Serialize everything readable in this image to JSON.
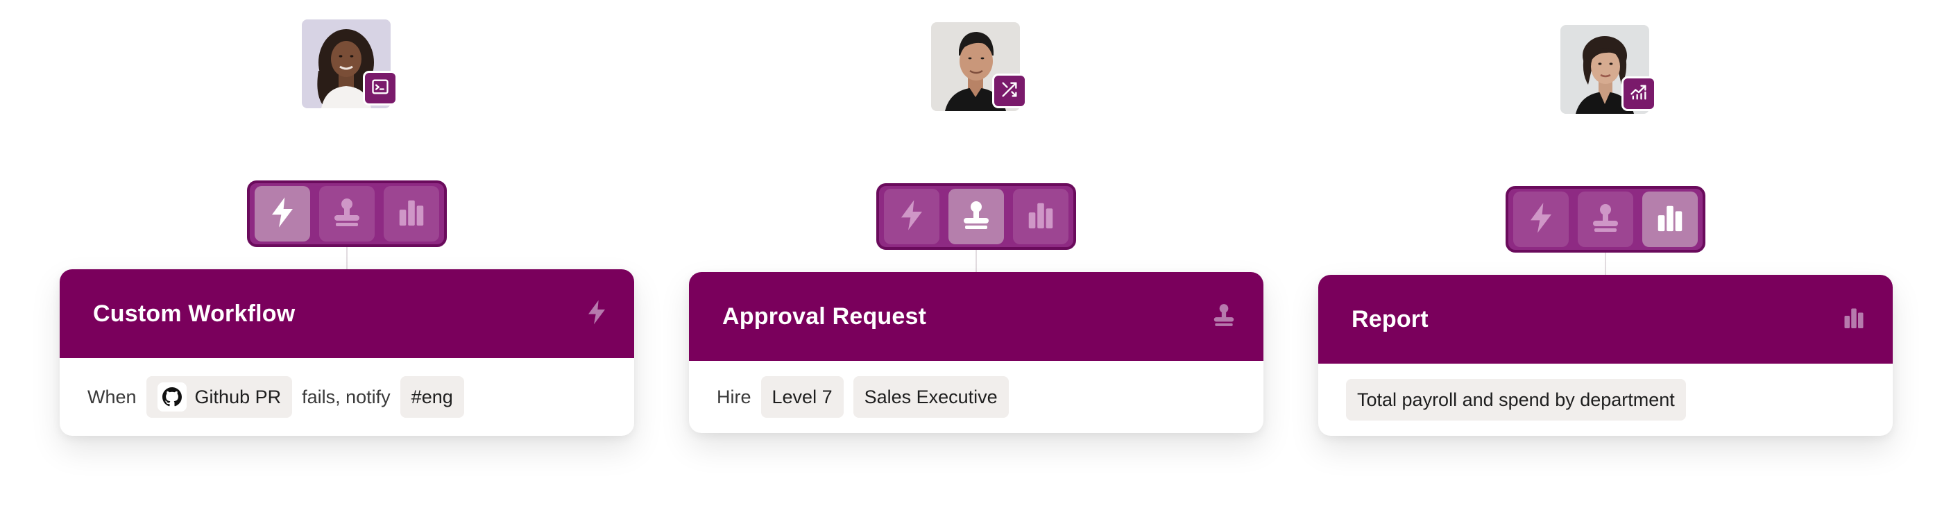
{
  "colors": {
    "brand": "#7a005c",
    "toggle_bg": "#8e2a83",
    "chip_bg": "#f1eeec"
  },
  "cards": [
    {
      "avatar_icon": "terminal-icon",
      "active_toggle": "lightning",
      "title": "Custom Workflow",
      "header_icon": "lightning-icon",
      "body": {
        "when_text": "When",
        "source_chip": "Github PR",
        "source_icon": "github-icon",
        "middle_text": "fails, notify",
        "target_chip": "#eng"
      }
    },
    {
      "avatar_icon": "arrows-diagonal-icon",
      "active_toggle": "stamp",
      "title": "Approval Request",
      "header_icon": "stamp-icon",
      "body": {
        "hire_text": "Hire",
        "level_chip": "Level 7",
        "role_chip": "Sales Executive"
      }
    },
    {
      "avatar_icon": "trending-chart-icon",
      "active_toggle": "bar-chart",
      "title": "Report",
      "header_icon": "bar-chart-icon",
      "body": {
        "report_chip": "Total payroll and spend by department"
      }
    }
  ]
}
